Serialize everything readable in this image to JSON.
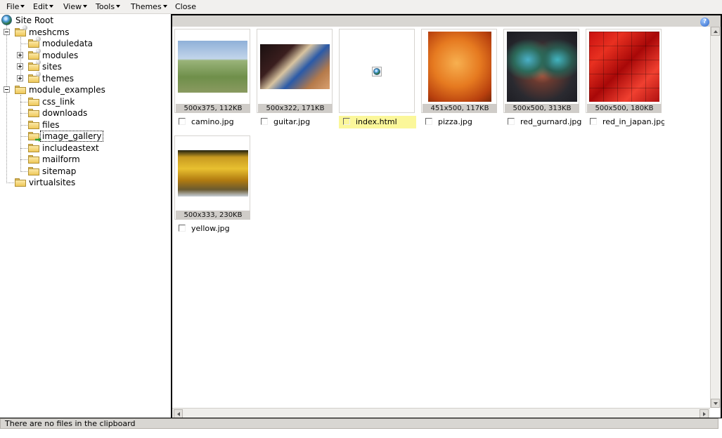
{
  "menu": {
    "items": [
      {
        "label": "File"
      },
      {
        "label": "Edit"
      },
      {
        "label": "View"
      },
      {
        "label": "Tools"
      },
      {
        "label": "Themes"
      },
      {
        "label": "Close"
      }
    ]
  },
  "tree": {
    "root": "Site Root",
    "nodes": [
      {
        "label": "meshcms",
        "state": "expanded"
      },
      {
        "label": "moduledata"
      },
      {
        "label": "modules",
        "state": "collapsed"
      },
      {
        "label": "sites",
        "state": "collapsed"
      },
      {
        "label": "themes",
        "state": "collapsed"
      },
      {
        "label": "module_examples",
        "state": "expanded"
      },
      {
        "label": "css_link"
      },
      {
        "label": "downloads"
      },
      {
        "label": "files"
      },
      {
        "label": "image_gallery",
        "selected": true
      },
      {
        "label": "includeastext"
      },
      {
        "label": "mailform"
      },
      {
        "label": "sitemap"
      },
      {
        "label": "virtualsites"
      }
    ]
  },
  "files": [
    {
      "name": "camino.jpg",
      "dims": "500x375, 112KB"
    },
    {
      "name": "guitar.jpg",
      "dims": "500x322, 171KB"
    },
    {
      "name": "index.html",
      "dims": "",
      "highlighted": true
    },
    {
      "name": "pizza.jpg",
      "dims": "451x500, 117KB"
    },
    {
      "name": "red_gurnard.jpg",
      "dims": "500x500, 313KB"
    },
    {
      "name": "red_in_japan.jpg",
      "dims": "500x500, 180KB"
    },
    {
      "name": "yellow.jpg",
      "dims": "500x333, 230KB"
    }
  ],
  "toolbar": {
    "help_icon": "?"
  },
  "status": {
    "text": "There are no files in the clipboard"
  },
  "colors": {
    "menubar": "#f1f0ee",
    "panel_toolbar": "#d8d6d2",
    "highlight": "#fbf79a",
    "folder": "#efc85a"
  }
}
